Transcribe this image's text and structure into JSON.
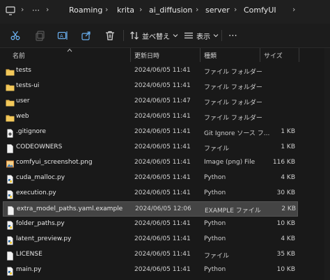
{
  "breadcrumb": {
    "items": [
      "Roaming",
      "krita",
      "ai_diffusion",
      "server",
      "ComfyUI"
    ],
    "more": "⋯"
  },
  "toolbar": {
    "sort_label": "並べ替え",
    "view_label": "表示",
    "more_label": "⋯"
  },
  "columns": {
    "name": "名前",
    "date": "更新日時",
    "type": "種類",
    "size": "サイズ"
  },
  "files": [
    {
      "name": "tests",
      "date": "2024/06/05 11:41",
      "type": "ファイル フォルダー",
      "size": "",
      "icon": "folder-icon"
    },
    {
      "name": "tests-ui",
      "date": "2024/06/05 11:41",
      "type": "ファイル フォルダー",
      "size": "",
      "icon": "folder-icon"
    },
    {
      "name": "user",
      "date": "2024/06/05 11:47",
      "type": "ファイル フォルダー",
      "size": "",
      "icon": "folder-icon"
    },
    {
      "name": "web",
      "date": "2024/06/05 11:41",
      "type": "ファイル フォルダー",
      "size": "",
      "icon": "folder-icon"
    },
    {
      "name": ".gitignore",
      "date": "2024/06/05 11:41",
      "type": "Git Ignore ソース フ...",
      "size": "1 KB",
      "icon": "git-file-icon"
    },
    {
      "name": "CODEOWNERS",
      "date": "2024/06/05 11:41",
      "type": "ファイル",
      "size": "1 KB",
      "icon": "file-icon"
    },
    {
      "name": "comfyui_screenshot.png",
      "date": "2024/06/05 11:41",
      "type": "Image (png) File",
      "size": "116 KB",
      "icon": "image-file-icon"
    },
    {
      "name": "cuda_malloc.py",
      "date": "2024/06/05 11:41",
      "type": "Python",
      "size": "4 KB",
      "icon": "python-file-icon"
    },
    {
      "name": "execution.py",
      "date": "2024/06/05 11:41",
      "type": "Python",
      "size": "30 KB",
      "icon": "python-file-icon"
    },
    {
      "name": "extra_model_paths.yaml.example",
      "date": "2024/06/05 12:06",
      "type": "EXAMPLE ファイル",
      "size": "2 KB",
      "icon": "file-icon",
      "selected": true
    },
    {
      "name": "folder_paths.py",
      "date": "2024/06/05 11:41",
      "type": "Python",
      "size": "10 KB",
      "icon": "python-file-icon"
    },
    {
      "name": "latent_preview.py",
      "date": "2024/06/05 11:41",
      "type": "Python",
      "size": "4 KB",
      "icon": "python-file-icon"
    },
    {
      "name": "LICENSE",
      "date": "2024/06/05 11:41",
      "type": "ファイル",
      "size": "35 KB",
      "icon": "file-icon"
    },
    {
      "name": "main.py",
      "date": "2024/06/05 11:41",
      "type": "Python",
      "size": "10 KB",
      "icon": "python-file-icon"
    }
  ],
  "colors": {
    "folder": "#e8b84a",
    "selected_row": "#444444",
    "background": "#191919"
  }
}
